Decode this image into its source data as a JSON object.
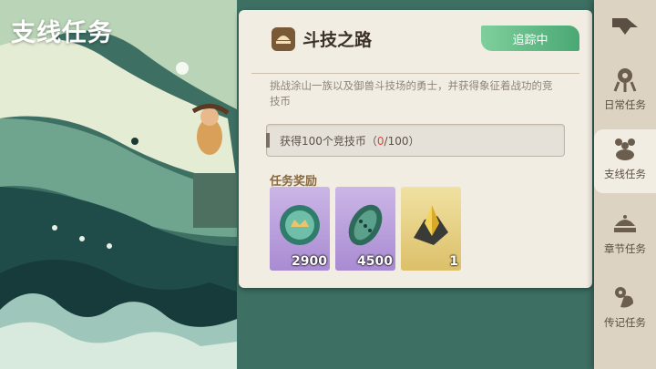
{
  "page": {
    "title": "支线任务"
  },
  "quest": {
    "title": "斗技之路",
    "status": "追踪中",
    "description": "挑战涂山一族以及御兽斗技场的勇士，并获得象征着战功的竞技币",
    "progress_prefix": "获得100个竞技币（",
    "progress_current": "0",
    "progress_total": "/100）"
  },
  "rewards": {
    "heading": "任务奖励",
    "items": [
      {
        "icon": "arena-coin-icon",
        "count": "2900"
      },
      {
        "icon": "leaf-token-icon",
        "count": "4500"
      },
      {
        "icon": "gold-crystal-icon",
        "count": "1"
      }
    ]
  },
  "sidebar": {
    "items": [
      {
        "label": "日常任务",
        "icon": "daily-task-icon"
      },
      {
        "label": "支线任务",
        "icon": "side-task-icon"
      },
      {
        "label": "章节任务",
        "icon": "chapter-task-icon"
      },
      {
        "label": "传记任务",
        "icon": "biography-task-icon"
      }
    ]
  },
  "colors": {
    "accent_green": "#4aa874",
    "panel": "#f2ede3",
    "progress_current": "#d44a3a"
  }
}
